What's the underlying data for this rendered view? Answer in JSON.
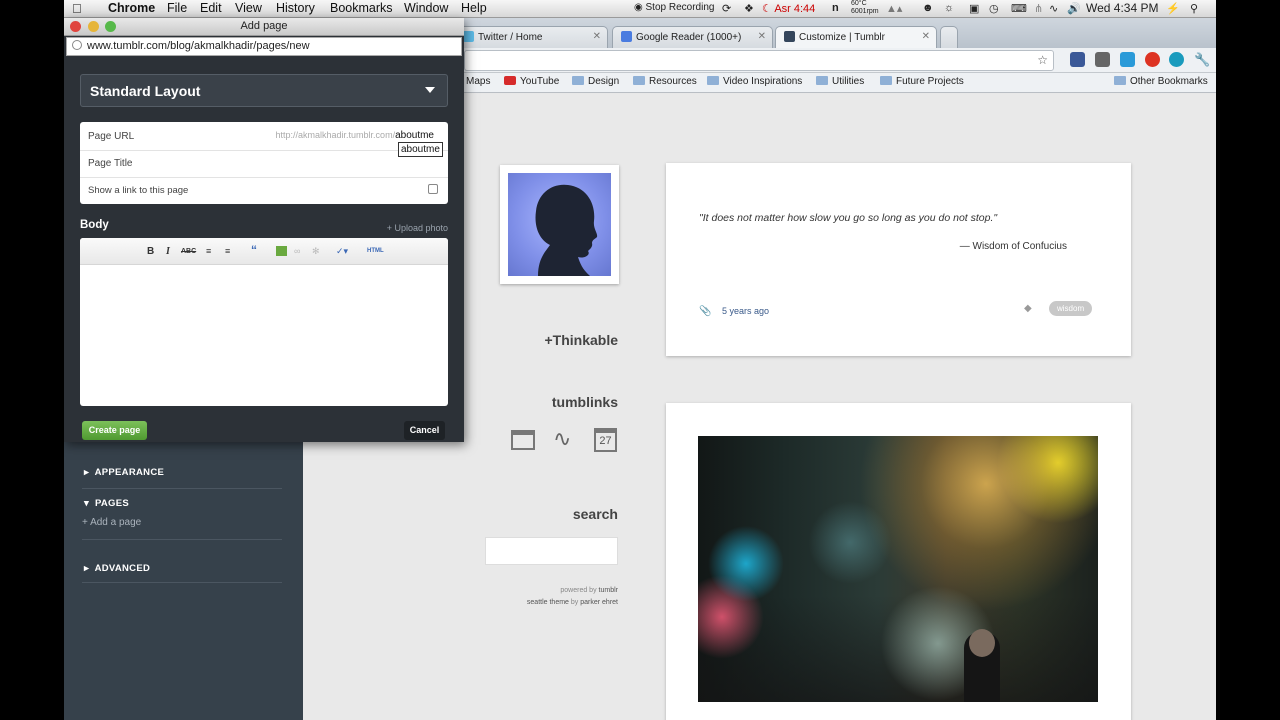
{
  "menubar": {
    "app_name": "Chrome",
    "items": [
      "File",
      "Edit",
      "View",
      "History",
      "Bookmarks",
      "Window",
      "Help"
    ],
    "stop_recording": "Stop Recording",
    "prayer": "Asr 4:44",
    "temp": "60°C",
    "rpm": "6001rpm",
    "clock": "Wed 4:34 PM"
  },
  "tabs": [
    {
      "label": "Twitter / Home"
    },
    {
      "label": "Google Reader (1000+)"
    },
    {
      "label": "Customize | Tumblr"
    }
  ],
  "bookmarks": [
    {
      "label": "Maps"
    },
    {
      "label": "YouTube"
    },
    {
      "label": "Design"
    },
    {
      "label": "Resources"
    },
    {
      "label": "Video Inspirations"
    },
    {
      "label": "Utilities"
    },
    {
      "label": "Future Projects"
    }
  ],
  "other_bookmarks": "Other Bookmarks",
  "dialog": {
    "title": "Add page",
    "url": "www.tumblr.com/blog/akmalkhadir/pages/new",
    "layout": "Standard Layout",
    "page_url_label": "Page URL",
    "page_url_prefix": "http://akmalkhadir.tumblr.com/",
    "page_url_value": "aboutme",
    "autocomplete": "aboutme",
    "page_title_label": "Page Title",
    "show_link_label": "Show a link to this page",
    "body_label": "Body",
    "upload_photo": "+ Upload photo",
    "toolbar": {
      "bold": "B",
      "italic": "I",
      "strike": "ABC",
      "quote": "“",
      "html": "HTML"
    },
    "create_button": "Create page",
    "cancel_button": "Cancel"
  },
  "sidebar": {
    "appearance": "APPEARANCE",
    "pages": "PAGES",
    "add_page": "+ Add a page",
    "advanced": "ADVANCED"
  },
  "blog": {
    "thinkable": "+Thinkable",
    "tumblinks": "tumblinks",
    "calendar_day": "27",
    "search_heading": "search",
    "powered_by": "powered by",
    "powered_by_link": "tumblr",
    "theme_name": "seattle theme",
    "theme_by": "by",
    "theme_author": "parker ehret",
    "quote": "\"It does not matter how slow you go so long as you do not stop.\"",
    "quote_source": "— Wisdom of Confucius",
    "post_time": "5 years ago",
    "post_tag": "wisdom"
  }
}
